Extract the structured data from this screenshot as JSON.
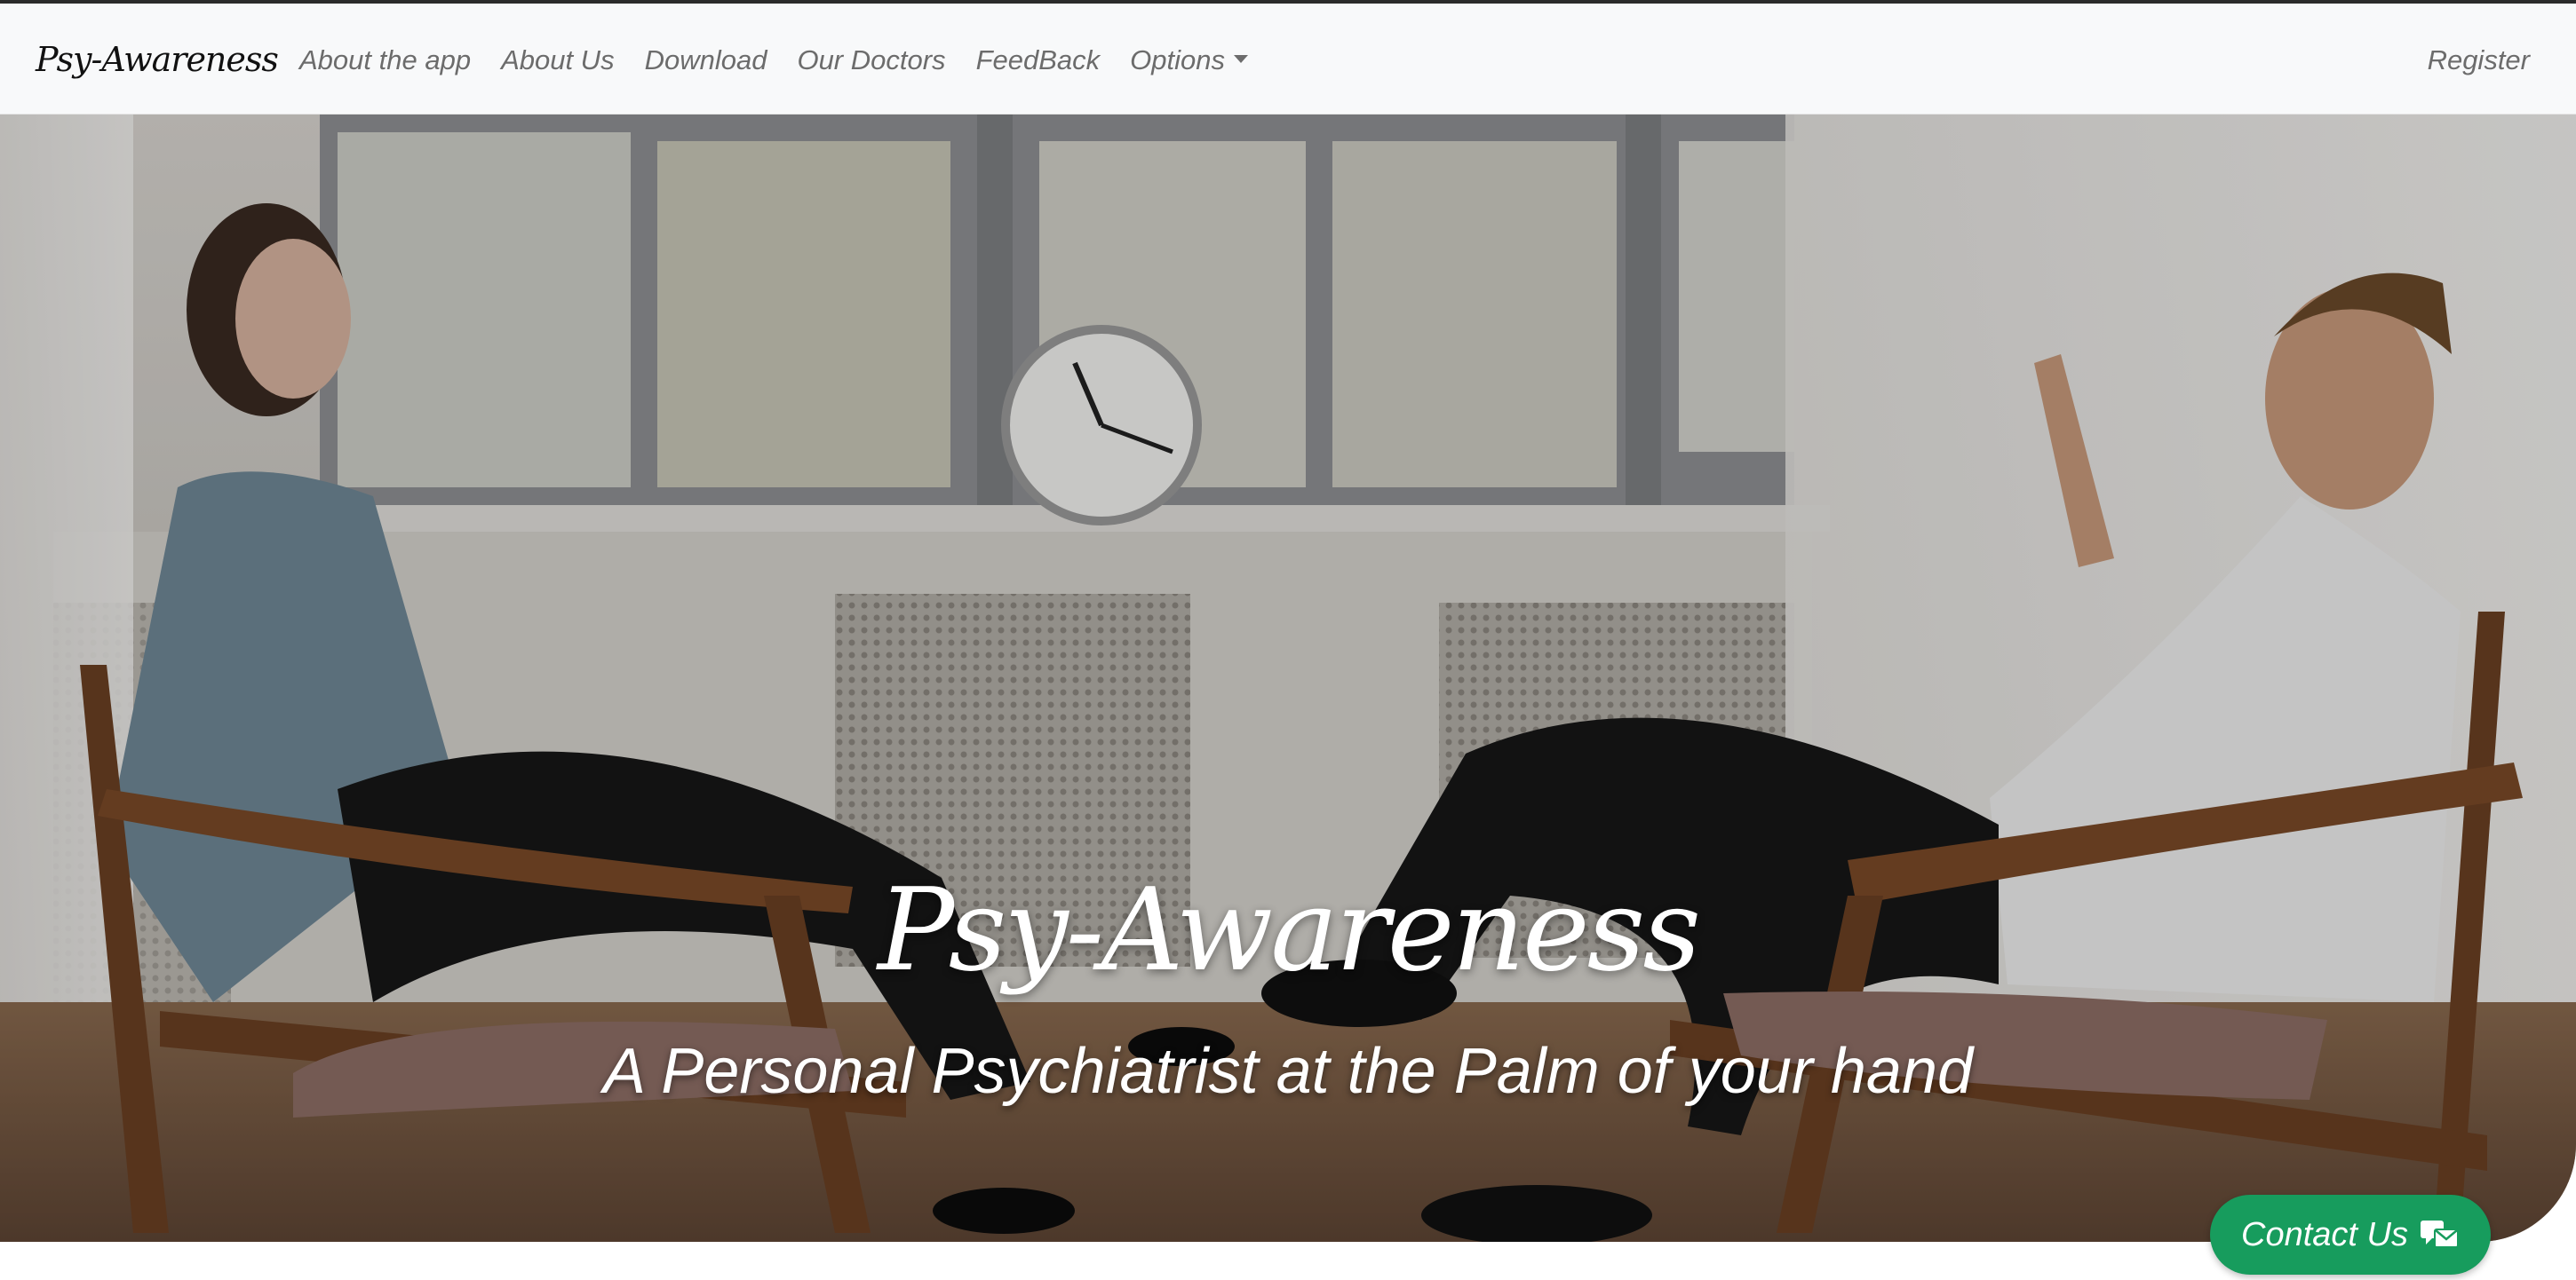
{
  "navbar": {
    "brand": "Psy-Awareness",
    "links": [
      "About the app",
      "About Us",
      "Download",
      "Our Doctors",
      "FeedBack",
      "Options"
    ],
    "register": "Register"
  },
  "hero": {
    "title": "Psy-Awareness",
    "subtitle": "A Personal Psychiatrist at the Palm of your hand"
  },
  "contact": {
    "label": "Contact Us",
    "icon": "mail-bubble-icon",
    "color": "#179c5d"
  },
  "colors": {
    "navbar_bg": "#f8f9fa",
    "nav_text": "#6c6c6c",
    "accent": "#179c5d"
  }
}
